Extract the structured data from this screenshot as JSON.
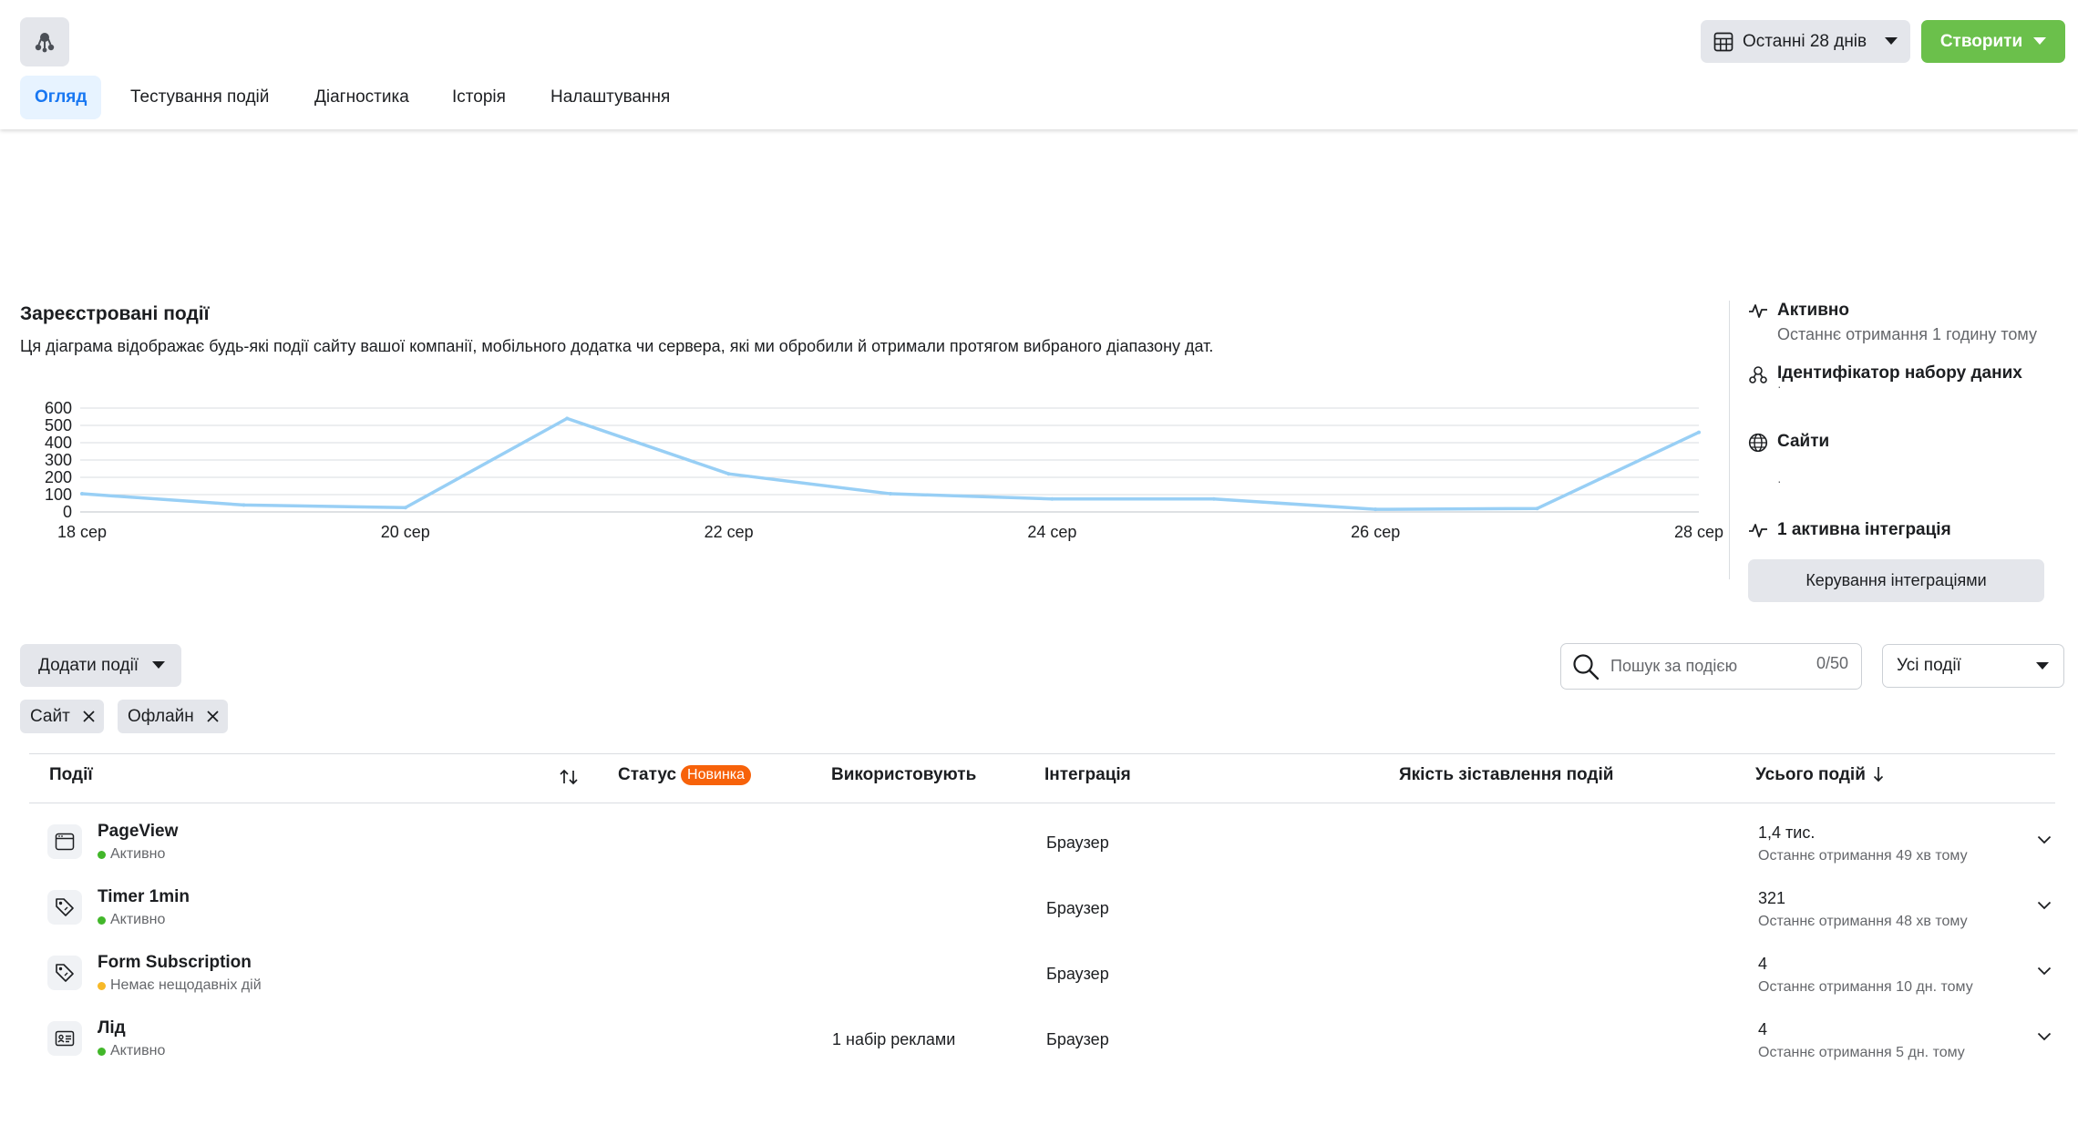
{
  "header": {
    "tabs": [
      {
        "label": "Огляд",
        "active": true
      },
      {
        "label": "Тестування подій"
      },
      {
        "label": "Діагностика"
      },
      {
        "label": "Історія"
      },
      {
        "label": "Налаштування"
      }
    ],
    "date_range_label": "Останні 28 днів",
    "create_label": "Створити"
  },
  "section": {
    "title": "Зареєстровані події",
    "description": "Ця діаграма відображає будь-які події сайту вашої компанії, мобільного додатка чи сервера, які ми обробили й отримали протягом вибраного діапазону дат."
  },
  "chart_data": {
    "type": "line",
    "x": [
      "18 сер",
      "19 сер",
      "20 сер",
      "21 сер",
      "22 сер",
      "23 сер",
      "24 сер",
      "25 сер",
      "26 сер",
      "27 сер",
      "28 сер"
    ],
    "x_tick_labels": [
      "18 сер",
      "20 сер",
      "22 сер",
      "24 сер",
      "26 сер",
      "28 сер"
    ],
    "series": [
      {
        "values": [
          105,
          40,
          25,
          540,
          220,
          105,
          75,
          75,
          15,
          20,
          460
        ],
        "color": "#98cff5"
      }
    ],
    "y_ticks": [
      0,
      100,
      200,
      300,
      400,
      500,
      600
    ],
    "ylim": [
      0,
      600
    ],
    "grid": true
  },
  "panel": {
    "status_title": "Активно",
    "status_sub": "Останнє отримання 1 годину тому",
    "dataset_title": "Ідентифікатор набору даних",
    "dataset_value": "·",
    "sites_title": "Сайти",
    "sites_value": "·",
    "integrations_title": "1 активна інтеграція",
    "manage_label": "Керування інтеграціями"
  },
  "toolbar": {
    "add_events_label": "Додати події",
    "chips": [
      "Сайт",
      "Офлайн"
    ],
    "search_placeholder": "Пошук за подією",
    "search_count": "0/50",
    "filter_label": "Усі події"
  },
  "table": {
    "headers": {
      "events": "Події",
      "status": "Статус",
      "new_badge": "Новинка",
      "used_by": "Використовують",
      "integration": "Інтеграція",
      "match_quality": "Якість зіставлення подій",
      "total": "Усього подій"
    },
    "rows": [
      {
        "name": "PageView",
        "status": "Активно",
        "status_color": "#42b72a",
        "icon": "browser-window-icon",
        "used_by": "",
        "integration": "Браузер",
        "total": "1,4 тис.",
        "last_received": "Останнє отримання 49 хв тому"
      },
      {
        "name": "Timer 1min",
        "status": "Активно",
        "status_color": "#42b72a",
        "icon": "tag-icon",
        "used_by": "",
        "integration": "Браузер",
        "total": "321",
        "last_received": "Останнє отримання 48 хв тому"
      },
      {
        "name": "Form Subscription",
        "status": "Немає нещодавніх дій",
        "status_color": "#f7b928",
        "icon": "tag-icon",
        "used_by": "",
        "integration": "Браузер",
        "total": "4",
        "last_received": "Останнє отримання 10 дн. тому"
      },
      {
        "name": "Лід",
        "status": "Активно",
        "status_color": "#42b72a",
        "icon": "id-card-icon",
        "used_by": "1 набір реклами",
        "integration": "Браузер",
        "total": "4",
        "last_received": "Останнє отримання 5 дн. тому"
      }
    ]
  }
}
